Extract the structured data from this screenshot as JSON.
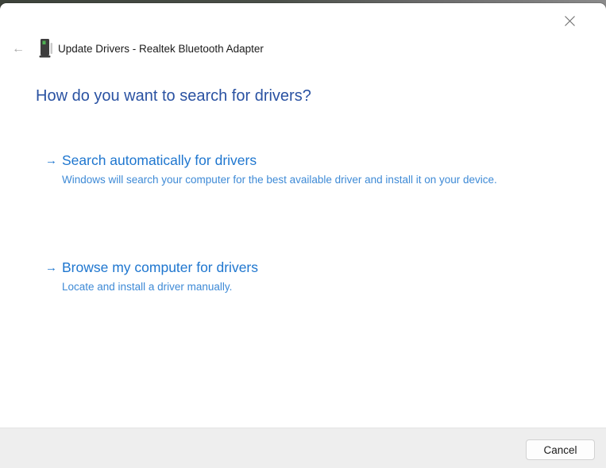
{
  "window": {
    "title": "Update Drivers - Realtek Bluetooth Adapter"
  },
  "icons": {
    "back_arrow": "←",
    "forward_arrow": "→",
    "close": "x",
    "device": "bluetooth-adapter-device"
  },
  "main": {
    "heading": "How do you want to search for drivers?",
    "options": [
      {
        "title": "Search automatically for drivers",
        "description": "Windows will search your computer for the best available driver and install it on your device."
      },
      {
        "title": "Browse my computer for drivers",
        "description": "Locate and install a driver manually."
      }
    ]
  },
  "footer": {
    "cancel_label": "Cancel"
  },
  "colors": {
    "heading_blue": "#2a52a2",
    "option_title_blue": "#1e76cf",
    "option_desc_blue": "#3e8ad6",
    "footer_bg": "#eeeeee",
    "window_bg": "#ffffff",
    "device_led_green": "#4db052"
  }
}
